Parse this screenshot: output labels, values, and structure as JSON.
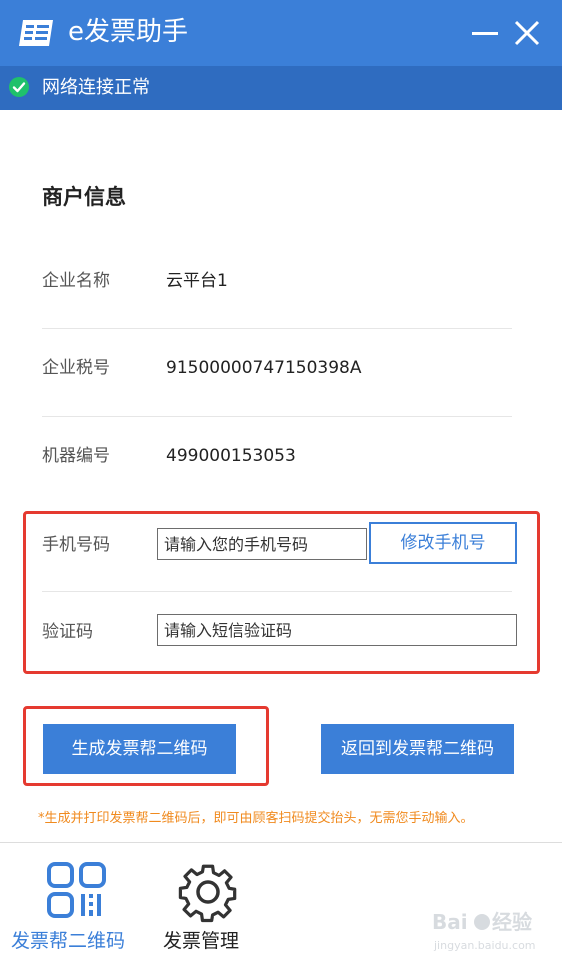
{
  "app": {
    "title": "e发票助手"
  },
  "status": {
    "text": "网络连接正常"
  },
  "merchant": {
    "section_title": "商户信息",
    "rows": [
      {
        "label": "企业名称",
        "value": "云平台1"
      },
      {
        "label": "企业税号",
        "value": "91500000747150398A"
      },
      {
        "label": "机器编号",
        "value": "499000153053"
      }
    ]
  },
  "form": {
    "phone_label": "手机号码",
    "phone_placeholder": "请输入您的手机号码",
    "change_phone_button": "修改手机号",
    "code_label": "验证码",
    "code_placeholder": "请输入短信验证码"
  },
  "actions": {
    "generate_button": "生成发票帮二维码",
    "return_button": "返回到发票帮二维码",
    "note": "*生成并打印发票帮二维码后，即可由顾客扫码提交抬头，无需您手动输入。"
  },
  "nav": {
    "items": [
      {
        "label": "发票帮二维码",
        "icon": "qr-grid-icon",
        "active": true
      },
      {
        "label": "发票管理",
        "icon": "gear-icon",
        "active": false
      }
    ]
  },
  "colors": {
    "primary": "#3b7fd8",
    "status_bar": "#2f6cc0",
    "highlight_red": "#e53a30",
    "note_orange": "#f08a1e",
    "status_ok": "#1fc16b"
  }
}
